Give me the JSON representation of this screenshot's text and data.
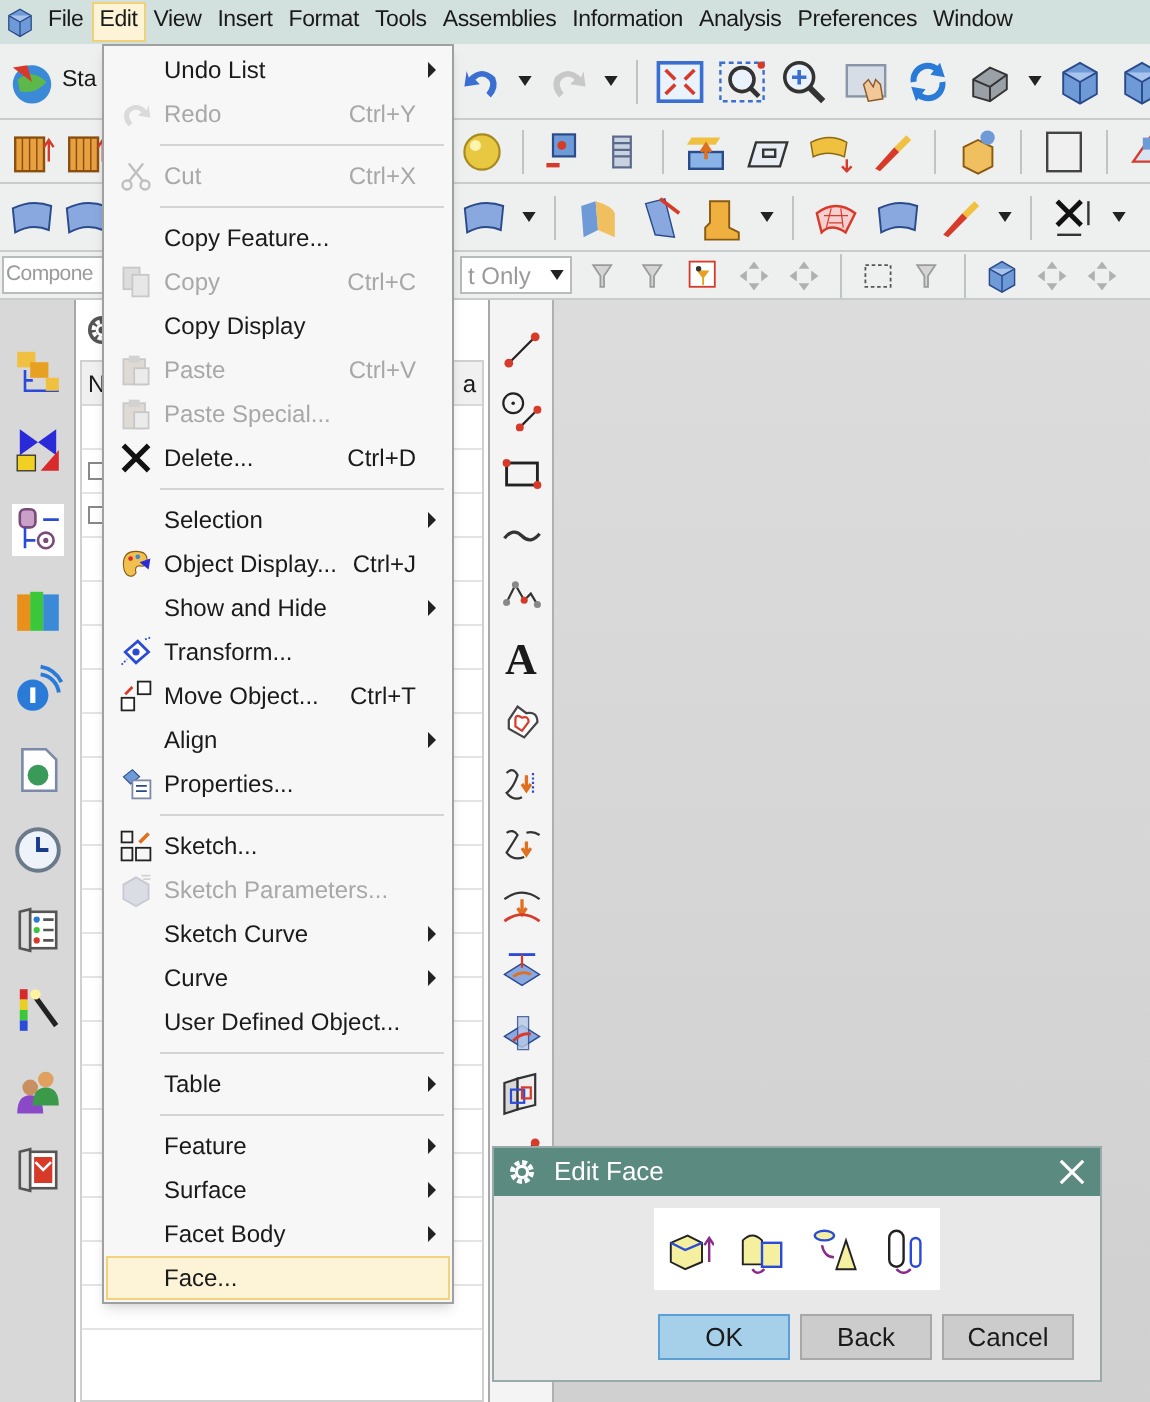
{
  "menubar": [
    {
      "label": "File",
      "selected": false
    },
    {
      "label": "Edit",
      "selected": true
    },
    {
      "label": "View",
      "selected": false
    },
    {
      "label": "Insert",
      "selected": false
    },
    {
      "label": "Format",
      "selected": false
    },
    {
      "label": "Tools",
      "selected": false
    },
    {
      "label": "Assemblies",
      "selected": false
    },
    {
      "label": "Information",
      "selected": false
    },
    {
      "label": "Analysis",
      "selected": false
    },
    {
      "label": "Preferences",
      "selected": false
    },
    {
      "label": "Window",
      "selected": false
    }
  ],
  "toolbar": {
    "start_label": "Sta",
    "component_filter": "Compone",
    "selection_scope": "t Only"
  },
  "resource_panel": {
    "columns": [
      "N",
      "a"
    ]
  },
  "sketch_toolbar": {
    "text_tool_glyph": "A"
  },
  "edit_menu": [
    {
      "kind": "item",
      "label": "Undo List",
      "submenu": true,
      "disabled": false,
      "selected": false
    },
    {
      "kind": "item",
      "label": "Redo",
      "shortcut": "Ctrl+Y",
      "submenu": false,
      "disabled": true,
      "selected": false
    },
    {
      "kind": "separator"
    },
    {
      "kind": "item",
      "label": "Cut",
      "shortcut": "Ctrl+X",
      "submenu": false,
      "disabled": true,
      "selected": false
    },
    {
      "kind": "separator"
    },
    {
      "kind": "item",
      "label": "Copy Feature...",
      "submenu": false,
      "disabled": false,
      "selected": false
    },
    {
      "kind": "item",
      "label": "Copy",
      "shortcut": "Ctrl+C",
      "submenu": false,
      "disabled": true,
      "selected": false
    },
    {
      "kind": "item",
      "label": "Copy Display",
      "submenu": false,
      "disabled": false,
      "selected": false
    },
    {
      "kind": "item",
      "label": "Paste",
      "shortcut": "Ctrl+V",
      "submenu": false,
      "disabled": true,
      "selected": false
    },
    {
      "kind": "item",
      "label": "Paste Special...",
      "submenu": false,
      "disabled": true,
      "selected": false
    },
    {
      "kind": "item",
      "label": "Delete...",
      "shortcut": "Ctrl+D",
      "submenu": false,
      "disabled": false,
      "selected": false
    },
    {
      "kind": "separator"
    },
    {
      "kind": "item",
      "label": "Selection",
      "submenu": true,
      "disabled": false,
      "selected": false
    },
    {
      "kind": "item",
      "label": "Object Display...",
      "shortcut": "Ctrl+J",
      "submenu": false,
      "disabled": false,
      "selected": false
    },
    {
      "kind": "item",
      "label": "Show and Hide",
      "submenu": true,
      "disabled": false,
      "selected": false
    },
    {
      "kind": "item",
      "label": "Transform...",
      "submenu": false,
      "disabled": false,
      "selected": false
    },
    {
      "kind": "item",
      "label": "Move Object...",
      "shortcut": "Ctrl+T",
      "submenu": false,
      "disabled": false,
      "selected": false
    },
    {
      "kind": "item",
      "label": "Align",
      "submenu": true,
      "disabled": false,
      "selected": false
    },
    {
      "kind": "item",
      "label": "Properties...",
      "submenu": false,
      "disabled": false,
      "selected": false
    },
    {
      "kind": "separator"
    },
    {
      "kind": "item",
      "label": "Sketch...",
      "submenu": false,
      "disabled": false,
      "selected": false
    },
    {
      "kind": "item",
      "label": "Sketch Parameters...",
      "submenu": false,
      "disabled": true,
      "selected": false
    },
    {
      "kind": "item",
      "label": "Sketch Curve",
      "submenu": true,
      "disabled": false,
      "selected": false
    },
    {
      "kind": "item",
      "label": "Curve",
      "submenu": true,
      "disabled": false,
      "selected": false
    },
    {
      "kind": "item",
      "label": "User Defined Object...",
      "submenu": false,
      "disabled": false,
      "selected": false
    },
    {
      "kind": "separator"
    },
    {
      "kind": "item",
      "label": "Table",
      "submenu": true,
      "disabled": false,
      "selected": false
    },
    {
      "kind": "separator"
    },
    {
      "kind": "item",
      "label": "Feature",
      "submenu": true,
      "disabled": false,
      "selected": false
    },
    {
      "kind": "item",
      "label": "Surface",
      "submenu": true,
      "disabled": false,
      "selected": false
    },
    {
      "kind": "item",
      "label": "Facet Body",
      "submenu": true,
      "disabled": false,
      "selected": false
    },
    {
      "kind": "item",
      "label": "Face...",
      "submenu": false,
      "disabled": false,
      "selected": true
    }
  ],
  "dialog": {
    "title": "Edit Face",
    "buttons": [
      {
        "label": "OK",
        "selected": true
      },
      {
        "label": "Back",
        "selected": false
      },
      {
        "label": "Cancel",
        "selected": false
      }
    ]
  }
}
